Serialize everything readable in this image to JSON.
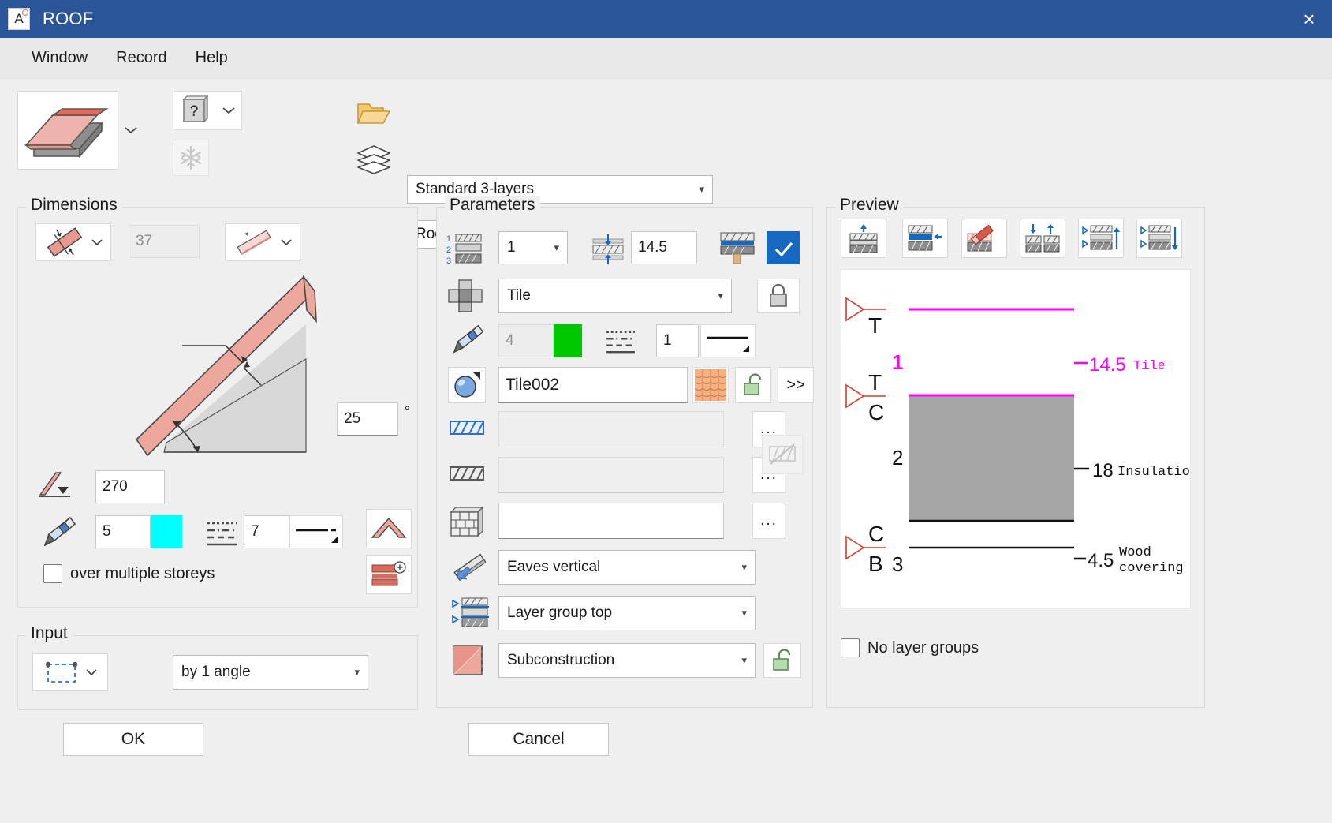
{
  "window": {
    "title": "ROOF",
    "app_icon": "roof-app-icon",
    "close_label": "×"
  },
  "menubar": {
    "items": [
      {
        "label": "Window",
        "name": "menu-window"
      },
      {
        "label": "Record",
        "name": "menu-record"
      },
      {
        "label": "Help",
        "name": "menu-help"
      }
    ]
  },
  "toolbar": {
    "roof_type_icon": "roof-3d-icon",
    "help_label": "?",
    "freeze_icon": "snowflake-icon",
    "folder_icon": "open-folder-icon",
    "layers_icon": "layers-stack-icon",
    "favourite": "Standard 3-layers",
    "component": "Roof"
  },
  "dimensions": {
    "legend": "Dimensions",
    "thickness_mode_icon": "roof-thickness-icon",
    "thickness_value": "37",
    "reference_icon": "roof-reference-line-icon",
    "angle_value": "25",
    "angle_unit": "°",
    "height_icon": "roof-height-icon",
    "height_value": "270",
    "pen_icon": "pencil-icon",
    "pen_value": "5",
    "pen_color": "#00ffff",
    "linetype_icon": "line-type-icon",
    "linetype_value": "7",
    "line_preview_icon": "line-style-preview-icon",
    "over_storeys_label": "over multiple storeys",
    "over_storeys_checked": false,
    "ridge_btn_icon": "roof-ridge-icon",
    "ruler_btn_icon": "roof-ruler-icon"
  },
  "input": {
    "legend": "Input",
    "method_icon": "rectangle-input-icon",
    "mode": "by 1 angle"
  },
  "parameters": {
    "legend": "Parameters",
    "layer_index_icon": "layer-numbering-icon",
    "layer_index": "1",
    "layer_thickness_icon": "layer-thickness-icon",
    "layer_thickness": "14.5",
    "load_bearing_icon": "load-bearing-layer-icon",
    "load_bearing_checked": true,
    "material_icon": "component-icon",
    "material": "Tile",
    "lock_icon": "lock-closed-icon",
    "pen_icon": "pencil-icon",
    "pen_value": "4",
    "pen_color": "#00c800",
    "linetype_icon": "line-type-icon",
    "linetype_value": "1",
    "line_preview_icon": "line-style-preview-icon",
    "surface_icon": "surface-sphere-icon",
    "surface_name": "Tile002",
    "surface_swatch_icon": "tile-pattern-swatch",
    "surface_lock_icon": "lock-open-icon",
    "surface_more": ">>",
    "hatch1_icon": "hatch-blue-icon",
    "hatch1_value": "",
    "hatch1_more": "...",
    "hatch2_icon": "hatch-grey-icon",
    "hatch2_value": "",
    "hatch2_more": "...",
    "masonry_icon": "masonry-icon",
    "masonry_value": "",
    "masonry_more": "...",
    "hatch_disabled_icon": "hatch-disabled-icon",
    "eaves_icon": "eaves-icon",
    "eaves": "Eaves vertical",
    "layergroup_icon": "layer-group-icon",
    "layergroup": "Layer group top",
    "subconstruction_icon": "subconstruction-icon",
    "subconstruction": "Subconstruction",
    "subconstruction_lock_icon": "lock-open-icon"
  },
  "preview": {
    "legend": "Preview",
    "toolbar_buttons": [
      {
        "name": "preview-align-top-icon",
        "icon": "align-top"
      },
      {
        "name": "preview-move-layer-icon",
        "icon": "move-layer"
      },
      {
        "name": "preview-paint-layer-icon",
        "icon": "paint-layer"
      },
      {
        "name": "preview-flip-layers-icon",
        "icon": "flip-layers"
      },
      {
        "name": "preview-layer-group-up-icon",
        "icon": "group-up"
      },
      {
        "name": "preview-layer-group-down-icon",
        "icon": "group-down"
      }
    ],
    "no_layer_groups_label": "No layer groups",
    "no_layer_groups_checked": false,
    "layers": [
      {
        "index": "1",
        "thickness": "14.5",
        "name": "Tile",
        "marks_top": "T",
        "marks_bottom": ""
      },
      {
        "index": "2",
        "thickness": "18",
        "name": "Insulation",
        "marks_top": "T",
        "marks_bottom": "C"
      },
      {
        "index": "3",
        "thickness": "4.5",
        "name": "Wood covering",
        "marks_top": "C",
        "marks_bottom": "B"
      }
    ]
  },
  "buttons": {
    "ok": "OK",
    "cancel": "Cancel"
  },
  "colors": {
    "titlebar": "#2a5699",
    "accent": "#1668c1",
    "roof_red": "#e8998e",
    "magenta": "#ff00ff"
  }
}
